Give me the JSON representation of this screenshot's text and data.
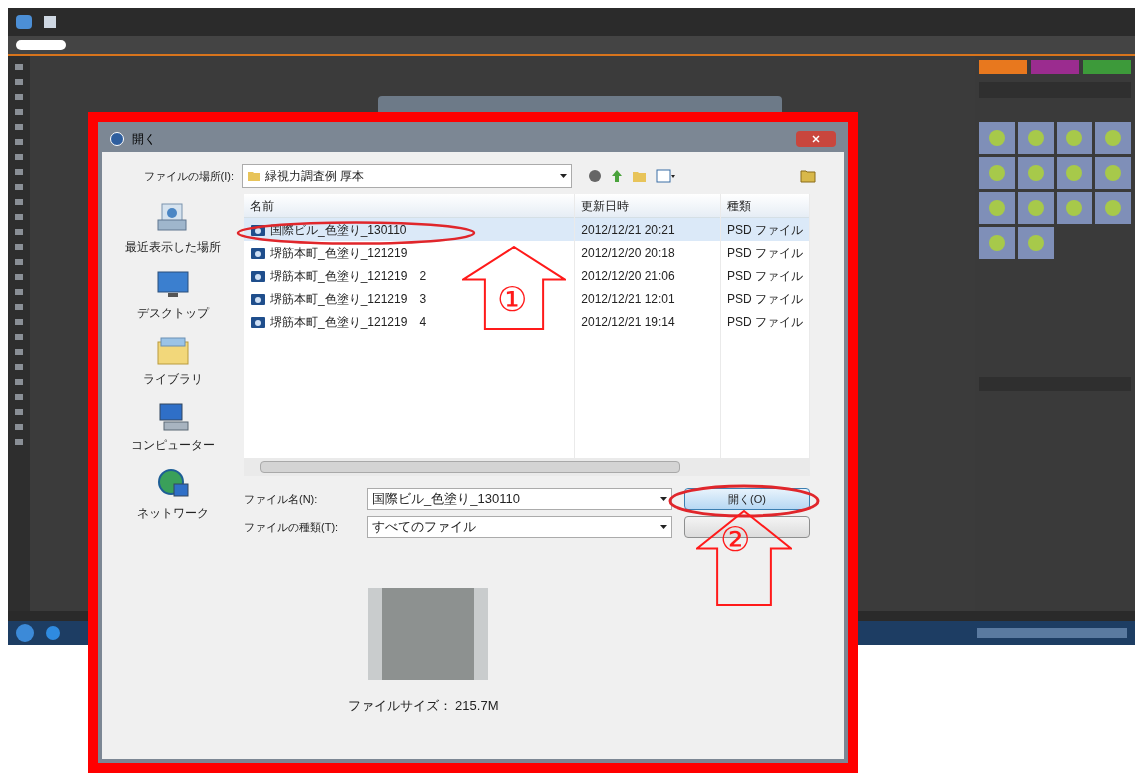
{
  "dialog": {
    "title": "開く",
    "location_label": "ファイルの場所(I):",
    "location": "緑視力調査例 厚本",
    "places": [
      {
        "kind": "recent",
        "label": "最近表示した場所"
      },
      {
        "kind": "desktop",
        "label": "デスクトップ"
      },
      {
        "kind": "library",
        "label": "ライブラリ"
      },
      {
        "kind": "computer",
        "label": "コンピューター"
      },
      {
        "kind": "network",
        "label": "ネットワーク"
      }
    ],
    "columns": [
      "名前",
      "更新日時",
      "種類"
    ],
    "files": [
      {
        "name": "国際ビル_色塗り_130110",
        "modified": "2012/12/21 20:21",
        "type": "PSD ファイル",
        "selected": true
      },
      {
        "name": "堺筋本町_色塗り_121219",
        "modified": "2012/12/20 20:18",
        "type": "PSD ファイル",
        "selected": false
      },
      {
        "name": "堺筋本町_色塗り_121219　2",
        "modified": "2012/12/20 21:06",
        "type": "PSD ファイル",
        "selected": false
      },
      {
        "name": "堺筋本町_色塗り_121219　3",
        "modified": "2012/12/21 12:01",
        "type": "PSD ファイル",
        "selected": false
      },
      {
        "name": "堺筋本町_色塗り_121219　4",
        "modified": "2012/12/21 19:14",
        "type": "PSD ファイル",
        "selected": false
      }
    ],
    "filename_label": "ファイル名(N):",
    "filename": "国際ビル_色塗り_130110",
    "filetype_label": "ファイルの種類(T):",
    "filetype": "すべてのファイル",
    "open_button": "開く(O)",
    "preview": {
      "size_text": "ファイルサイズ： 215.7M"
    }
  },
  "annotations": [
    {
      "number": "①"
    },
    {
      "number": "②"
    }
  ]
}
